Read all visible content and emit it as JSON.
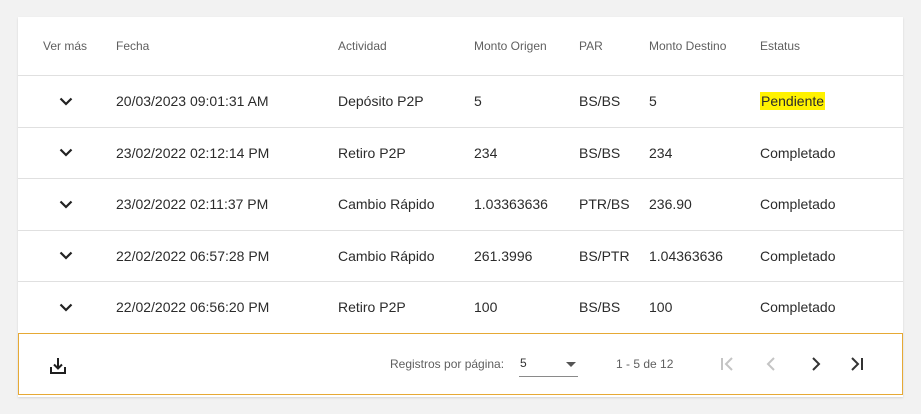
{
  "table": {
    "headers": {
      "ver_mas": "Ver más",
      "fecha": "Fecha",
      "actividad": "Actividad",
      "monto_origen": "Monto Origen",
      "par": "PAR",
      "monto_destino": "Monto Destino",
      "estatus": "Estatus"
    },
    "rows": [
      {
        "fecha": "20/03/2023 09:01:31 AM",
        "actividad": "Depósito P2P",
        "monto_origen": "5",
        "par": "BS/BS",
        "monto_destino": "5",
        "estatus": "Pendiente"
      },
      {
        "fecha": "23/02/2022 02:12:14 PM",
        "actividad": "Retiro P2P",
        "monto_origen": "234",
        "par": "BS/BS",
        "monto_destino": "234",
        "estatus": "Completado"
      },
      {
        "fecha": "23/02/2022 02:11:37 PM",
        "actividad": "Cambio Rápido",
        "monto_origen": "1.03363636",
        "par": "PTR/BS",
        "monto_destino": "236.90",
        "estatus": "Completado"
      },
      {
        "fecha": "22/02/2022 06:57:28 PM",
        "actividad": "Cambio Rápido",
        "monto_origen": "261.3996",
        "par": "BS/PTR",
        "monto_destino": "1.04363636",
        "estatus": "Completado"
      },
      {
        "fecha": "22/02/2022 06:56:20 PM",
        "actividad": "Retiro P2P",
        "monto_origen": "100",
        "par": "BS/BS",
        "monto_destino": "100",
        "estatus": "Completado"
      }
    ]
  },
  "footer": {
    "download_icon": "download-icon",
    "rows_per_page_label": "Registros por página:",
    "rows_per_page_value": "5",
    "range_text": "1 - 5 de 12",
    "nav_icons": [
      "first-page-icon",
      "previous-page-icon",
      "next-page-icon",
      "last-page-icon"
    ]
  },
  "colors": {
    "highlight": "#fff200",
    "footer_border": "#e6a935",
    "page_background": "#f2f2f2"
  }
}
